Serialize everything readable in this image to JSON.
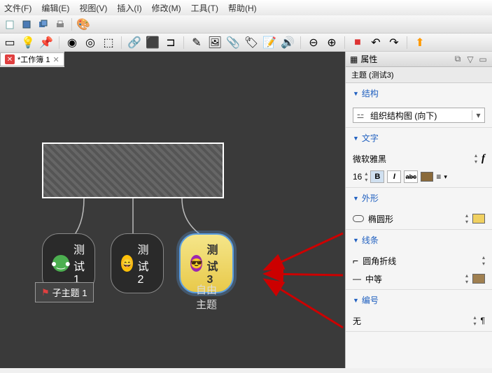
{
  "menu": {
    "file": "文件(F)",
    "edit": "编辑(E)",
    "view": "视图(V)",
    "insert": "插入(I)",
    "modify": "修改(M)",
    "tools": "工具(T)",
    "help": "帮助(H)"
  },
  "tab": {
    "label": "*工作簿 1",
    "close": "✕"
  },
  "nodes": {
    "child1": "测试1",
    "child2": "测试2",
    "child3": "测试3",
    "subtopic": "子主题 1",
    "free": "自由主题"
  },
  "panel": {
    "title": "属性",
    "subtitle": "主题 (测试3)",
    "sections": {
      "structure": "结构",
      "text": "文字",
      "shape": "外形",
      "line": "线条",
      "number": "编号"
    },
    "structure_value": "组织结构图 (向下)",
    "font_family": "微软雅黑",
    "font_size": "16",
    "bold": "B",
    "italic": "I",
    "strike": "abc",
    "shape_value": "椭圆形",
    "line_style": "圆角折线",
    "line_weight": "中等",
    "number_value": "无",
    "text_color": "#8a6a3a",
    "shape_color": "#f0d060",
    "line_color": "#a08050"
  }
}
